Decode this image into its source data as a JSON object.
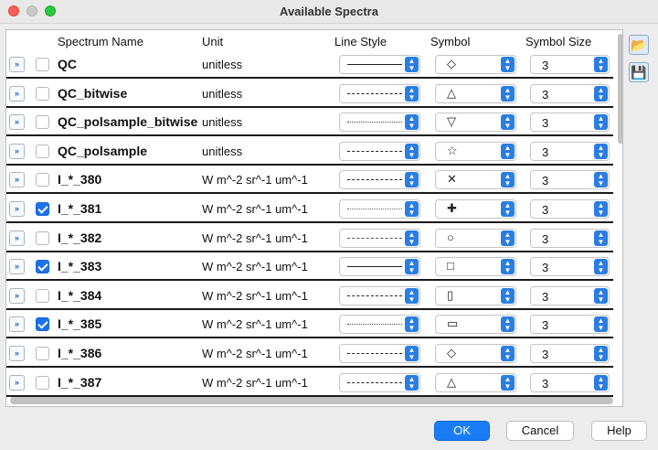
{
  "window": {
    "title": "Available Spectra"
  },
  "columns": {
    "name": "Spectrum Name",
    "unit": "Unit",
    "line_style": "Line Style",
    "symbol": "Symbol",
    "symbol_size": "Symbol Size"
  },
  "rows": [
    {
      "name": "QC",
      "unit": "unitless",
      "checked": false,
      "line_style": "solid",
      "symbol": "◇",
      "symbol_size": "3"
    },
    {
      "name": "QC_bitwise",
      "unit": "unitless",
      "checked": false,
      "line_style": "dashed",
      "symbol": "△",
      "symbol_size": "3"
    },
    {
      "name": "QC_polsample_bitwise",
      "unit": "unitless",
      "checked": false,
      "line_style": "dotted",
      "symbol": "▽",
      "symbol_size": "3"
    },
    {
      "name": "QC_polsample",
      "unit": "unitless",
      "checked": false,
      "line_style": "short-dashed",
      "symbol": "☆",
      "symbol_size": "3"
    },
    {
      "name": "I_*_380",
      "unit": "W m^-2 sr^-1 um^-1",
      "checked": false,
      "line_style": "long-dash",
      "symbol": "✕",
      "symbol_size": "3"
    },
    {
      "name": "I_*_381",
      "unit": "W m^-2 sr^-1 um^-1",
      "checked": true,
      "line_style": "sparse-dotted",
      "symbol": "✚",
      "symbol_size": "3"
    },
    {
      "name": "I_*_382",
      "unit": "W m^-2 sr^-1 um^-1",
      "checked": false,
      "line_style": "dash-dot",
      "symbol": "○",
      "symbol_size": "3"
    },
    {
      "name": "I_*_383",
      "unit": "W m^-2 sr^-1 um^-1",
      "checked": true,
      "line_style": "solid",
      "symbol": "□",
      "symbol_size": "3"
    },
    {
      "name": "I_*_384",
      "unit": "W m^-2 sr^-1 um^-1",
      "checked": false,
      "line_style": "dashed",
      "symbol": "▯",
      "symbol_size": "3"
    },
    {
      "name": "I_*_385",
      "unit": "W m^-2 sr^-1 um^-1",
      "checked": true,
      "line_style": "dotted",
      "symbol": "▭",
      "symbol_size": "3"
    },
    {
      "name": "I_*_386",
      "unit": "W m^-2 sr^-1 um^-1",
      "checked": false,
      "line_style": "short-dashed",
      "symbol": "◇",
      "symbol_size": "3"
    },
    {
      "name": "I_*_387",
      "unit": "W m^-2 sr^-1 um^-1",
      "checked": false,
      "line_style": "long-dash",
      "symbol": "△",
      "symbol_size": "3"
    }
  ],
  "side_icons": [
    "open-folder-icon",
    "save-icon"
  ],
  "buttons": {
    "ok": "OK",
    "cancel": "Cancel",
    "help": "Help"
  },
  "colors": {
    "accent": "#1a7cf4",
    "checkbox_checked": "#1a73e8"
  }
}
